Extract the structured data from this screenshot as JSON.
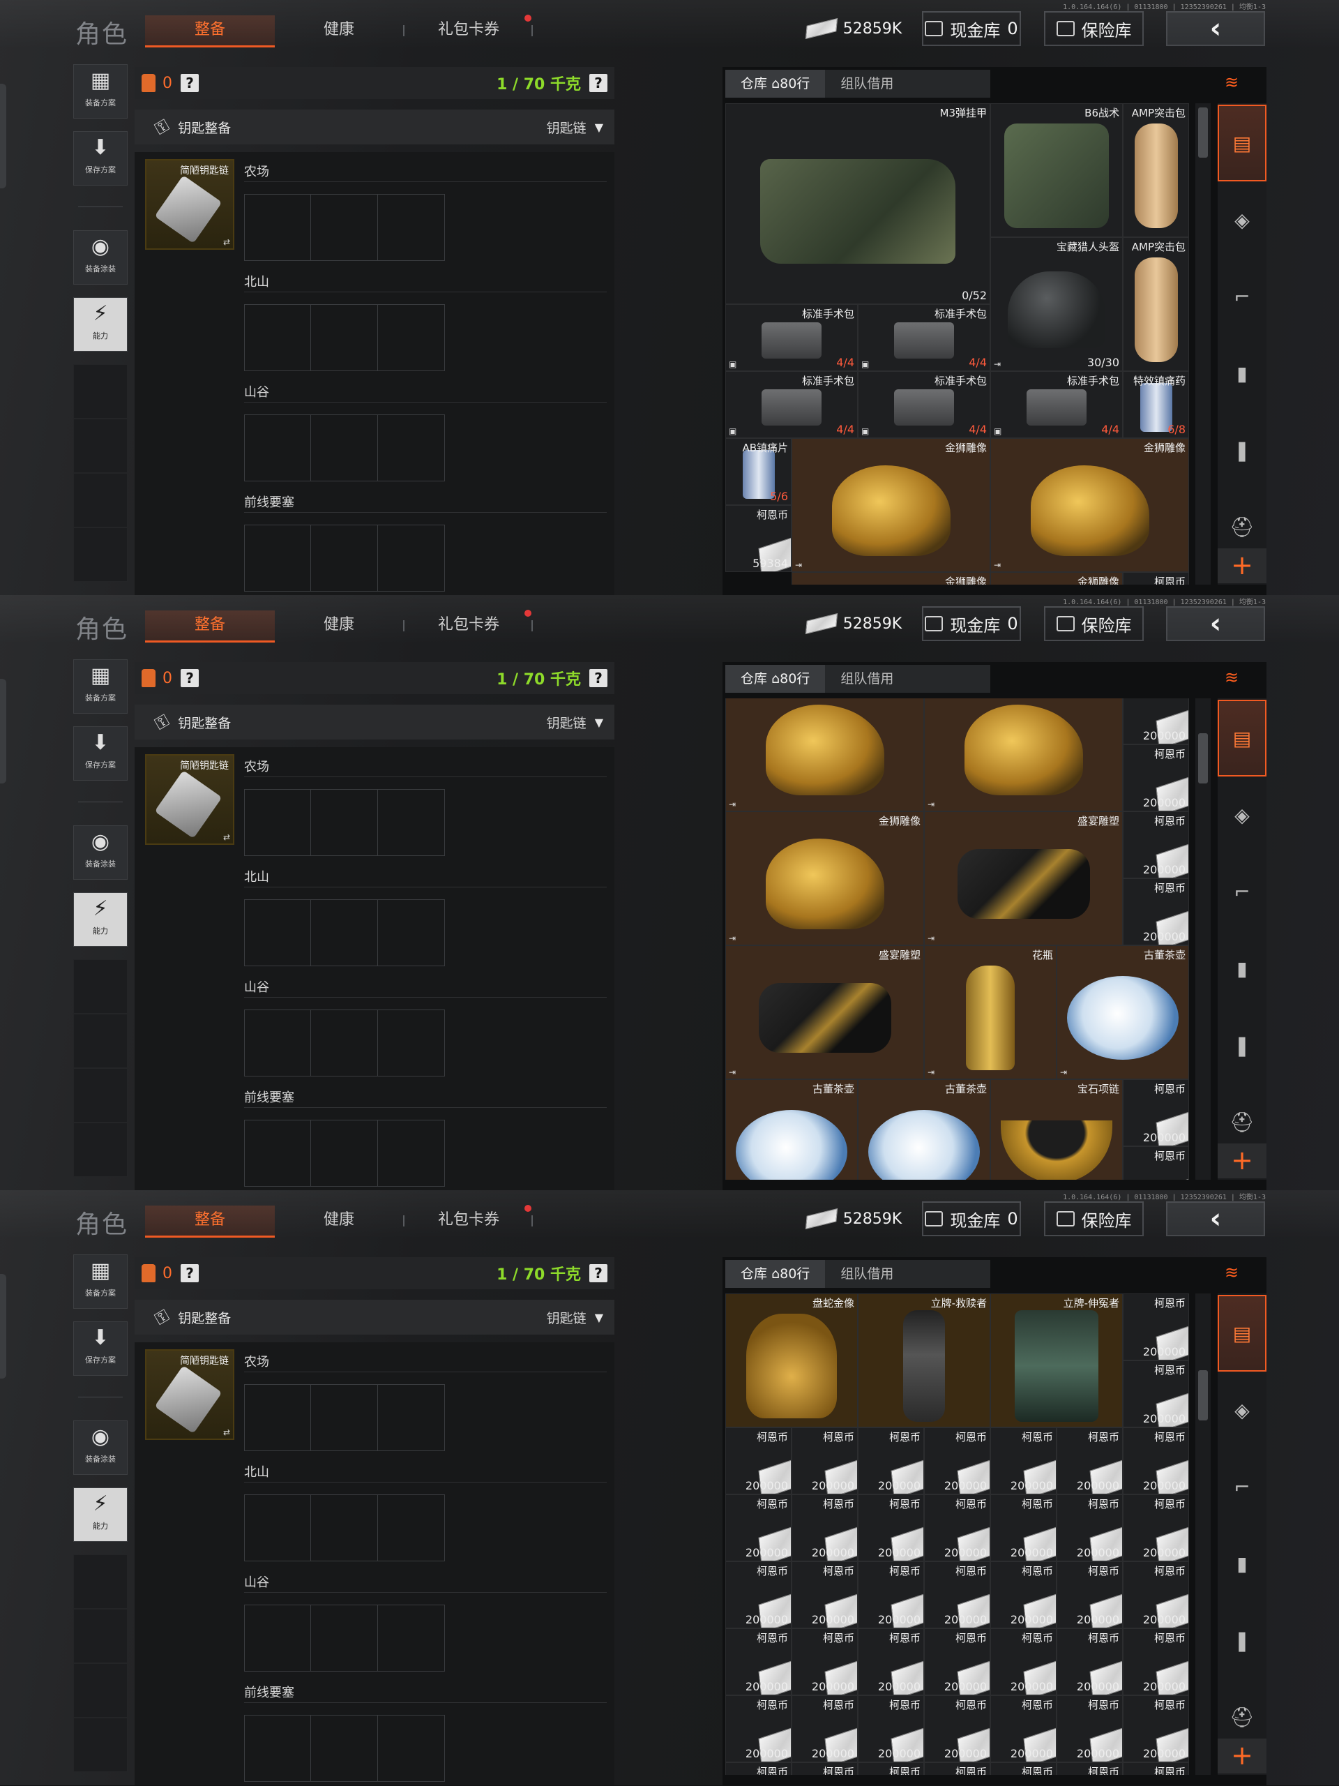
{
  "version": "1.0.164.164(6) | 01131800 | 12352390261 | 均衡1-3",
  "title": "角色",
  "tabs": [
    "整备",
    "健康",
    "礼包卡券"
  ],
  "header": {
    "money": "52859K",
    "cash_label": "现金库",
    "cash_value": "0",
    "vault_label": "保险库",
    "back_icon": "‹"
  },
  "left_buttons": [
    "装备方案",
    "保存方案",
    "装备涂装",
    "能力"
  ],
  "loadout": {
    "bag_count": "0",
    "weight": "1 / 70 千克",
    "key_title": "钥匙整备",
    "key_dropdown": "钥匙链",
    "key_item": "简陋钥匙链"
  },
  "regions": [
    "农场",
    "北山",
    "山谷",
    "前线要塞"
  ],
  "inventory": {
    "warehouse_tab": "仓库",
    "rows": "80行",
    "team_tab": "组队借用"
  },
  "screen1_items": [
    {
      "name": "M3弹挂甲",
      "count": "0/52"
    },
    {
      "name": "B6战术"
    },
    {
      "name": "AMP突击包"
    },
    {
      "name": "宝藏猎人头盔",
      "count": "30/30"
    },
    {
      "name": "AMP突击包"
    },
    {
      "name": "标准手术包",
      "count": "4/4"
    },
    {
      "name": "标准手术包",
      "count": "4/4"
    },
    {
      "name": "标准手术包",
      "count": "4/4"
    },
    {
      "name": "标准手术包",
      "count": "4/4"
    },
    {
      "name": "标准手术包",
      "count": "4/4"
    },
    {
      "name": "特效镇痛药",
      "count": "6/8"
    },
    {
      "name": "AB镇痛片",
      "count": "5/6"
    },
    {
      "name": "柯恩币",
      "count": "59384"
    },
    {
      "name": "金狮雕像"
    },
    {
      "name": "金狮雕像"
    },
    {
      "name": "金狮雕像"
    },
    {
      "name": "金狮雕像"
    },
    {
      "name": "柯恩币"
    }
  ],
  "screen2_items": [
    {
      "name": "金狮雕像"
    },
    {
      "name": "金狮雕像"
    },
    {
      "name": "金狮雕像"
    },
    {
      "name": "盛宴雕塑"
    },
    {
      "name": "盛宴雕塑"
    },
    {
      "name": "花瓶"
    },
    {
      "name": "古董茶壶"
    },
    {
      "name": "古董茶壶"
    },
    {
      "name": "古董茶壶"
    },
    {
      "name": "宝石项链"
    }
  ],
  "screen3_items": [
    {
      "name": "盘蛇金像"
    },
    {
      "name": "立牌-救赎者"
    },
    {
      "name": "立牌-伸冤者"
    }
  ],
  "coin": {
    "name": "柯恩币",
    "count": "200000"
  }
}
